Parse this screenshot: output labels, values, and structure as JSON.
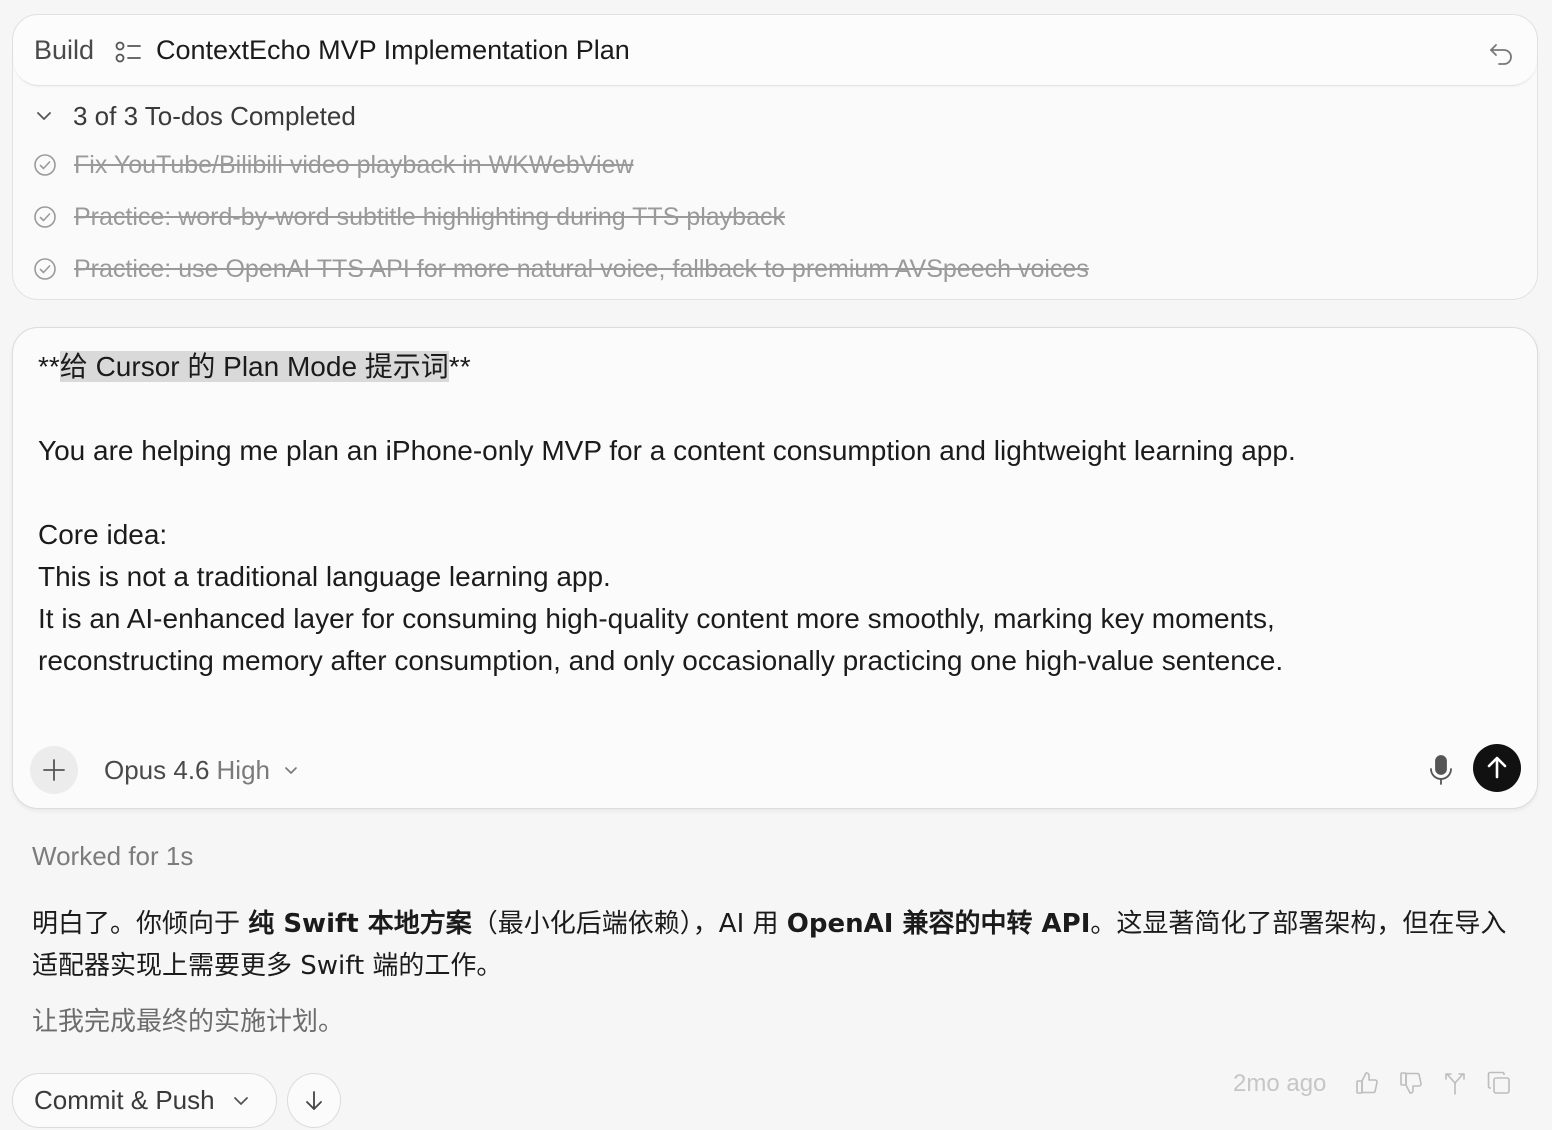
{
  "plan": {
    "mode_label": "Build",
    "title": "ContextEcho MVP Implementation Plan",
    "todo_summary": "3 of 3 To-dos Completed",
    "todos": [
      "Fix YouTube/Bilibili video playback in WKWebView",
      "Practice: word-by-word subtitle highlighting during TTS playback",
      "Practice: use OpenAI TTS API for more natural voice, fallback to premium AVSpeech voices"
    ]
  },
  "prompt": {
    "heading_prefix": "**",
    "heading_highlight": "给 Cursor 的 Plan Mode 提示词",
    "heading_suffix": "**",
    "line1": "You are helping me plan an iPhone-only MVP for a content consumption and lightweight learning app.",
    "line2": "Core idea:",
    "line3": "This is not a traditional language learning app.",
    "line4": "It is an AI-enhanced layer for consuming high-quality content more smoothly, marking key moments,",
    "line5": "reconstructing memory after consumption, and only occasionally practicing one high-value sentence."
  },
  "composer": {
    "model_name": "Opus 4.6",
    "model_level": "High"
  },
  "response": {
    "worked_for": "Worked for 1s",
    "p1_a": "明白了。你倾向于 ",
    "p1_b": "纯 Swift 本地方案",
    "p1_c": "（最小化后端依赖），AI 用 ",
    "p1_d": "OpenAI 兼容的中转 API",
    "p1_e": "。这显著简化了部署架构，但在导入适配器实现上需要更多 Swift 端的工作。",
    "p2": "让我完成最终的实施计划。"
  },
  "footer": {
    "commit_label": "Commit & Push",
    "timestamp": "2mo ago"
  },
  "icons": {
    "plan": "checklist-icon",
    "undo": "undo-icon",
    "todo": "check-circle-icon",
    "add": "plus-icon",
    "mic": "microphone-icon",
    "send": "arrow-up-icon",
    "thumbs_up": "thumbs-up-icon",
    "thumbs_down": "thumbs-down-icon",
    "fork": "fork-icon",
    "copy": "copy-icon"
  },
  "colors": {
    "send_button": "#111111",
    "highlight": "#d9d9d9",
    "muted_text": "#9a9a9a"
  }
}
